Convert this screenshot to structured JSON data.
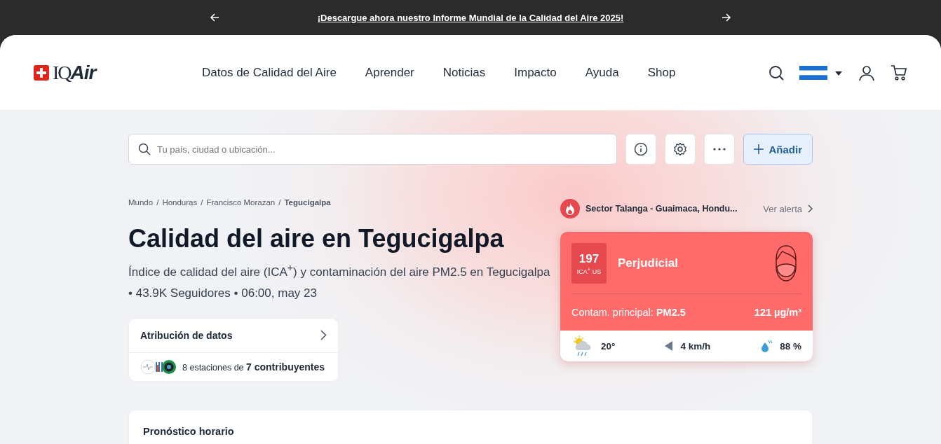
{
  "banner": {
    "text": "¡Descargue ahora nuestro Informe Mundial de la Calidad del Aire 2025!"
  },
  "header": {
    "logo": [
      "IQ",
      "Air"
    ],
    "nav": [
      "Datos de Calidad del Aire",
      "Aprender",
      "Noticias",
      "Impacto",
      "Ayuda",
      "Shop"
    ]
  },
  "search": {
    "placeholder": "Tu país, ciudad o ubicación...",
    "add_button": "Añadir"
  },
  "breadcrumb": {
    "separator": "/",
    "items": [
      "Mundo",
      "Honduras",
      "Francisco Morazan",
      "Tegucigalpa"
    ]
  },
  "title": "Calidad del aire en Tegucigalpa",
  "subtitle": "Índice de calidad del aire (ICA$^{+}$) y contaminación del aire PM2.5 en Tegucigalpa",
  "meta": "• 43.9K Seguidores • 06:00, may 23",
  "attribution": {
    "title": "Atribución de datos",
    "summary": "8 estaciones de **7 contribuyentes**"
  },
  "alert": {
    "text": "Sector Talanga - Guaimaca, Hondu...",
    "link": "Ver alerta"
  },
  "aqi": {
    "value": "197",
    "unit": "ICA$^{+}$ US",
    "status": "Perjudicial",
    "pollutant": "Contam. principal: **PM2.5**",
    "concentration": "121 µg/m³"
  },
  "weather": {
    "temperature": "20°",
    "wind": "4 km/h",
    "humidity": "88 %"
  },
  "forecast": {
    "title": "Pronóstico horario"
  }
}
